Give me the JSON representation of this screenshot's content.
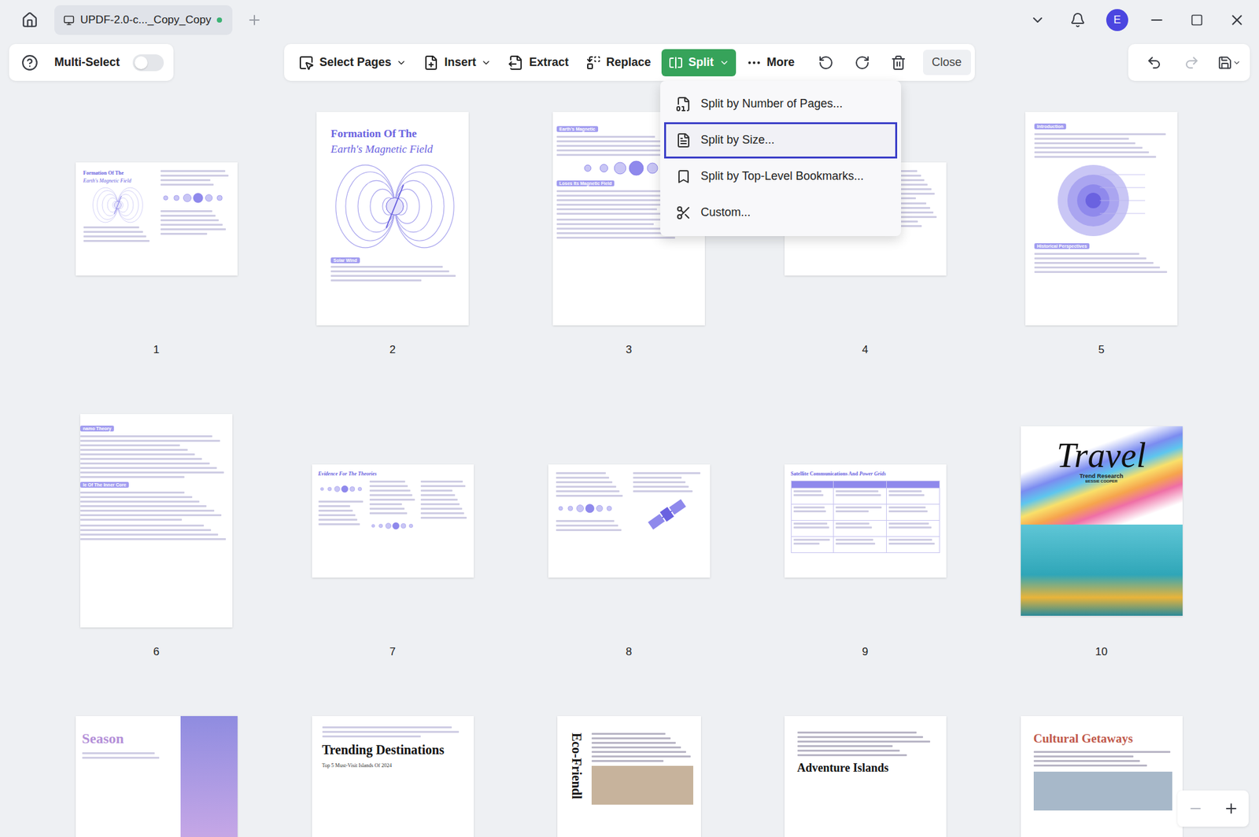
{
  "window": {
    "tabs": [
      {
        "label": "UPDF-2.0-c..._Copy_Copy",
        "selected": true,
        "unsaved": true
      }
    ],
    "account": {
      "initial": "E"
    }
  },
  "multi_select": {
    "label": "Multi-Select",
    "on": false
  },
  "toolbar": {
    "items": [
      {
        "label": "Select Pages",
        "kind": "menu",
        "selected": false
      },
      {
        "label": "Insert",
        "kind": "menu",
        "selected": false
      },
      {
        "label": "Extract",
        "kind": "button",
        "selected": false
      },
      {
        "label": "Replace",
        "kind": "button",
        "selected": false
      },
      {
        "label": "Split",
        "kind": "menu",
        "selected": true
      },
      {
        "label": "More",
        "kind": "button",
        "selected": false
      }
    ],
    "close": "Close"
  },
  "history": {
    "undo_disabled": false,
    "redo_disabled": true
  },
  "split_menu": {
    "open": true,
    "items": [
      {
        "label": "Split by Number of Pages...",
        "selected": false
      },
      {
        "label": "Split by Size...",
        "selected": true
      },
      {
        "label": "Split by Top-Level Bookmarks...",
        "selected": false
      },
      {
        "label": "Custom...",
        "selected": false
      }
    ]
  },
  "pages": [
    {
      "number": "1",
      "kind": "title-spread",
      "selected": false,
      "title": "Formation Of The",
      "subtitle": "Earth's Magnetic Field",
      "tags": []
    },
    {
      "number": "2",
      "kind": "field-cover",
      "selected": false,
      "title": "Formation Of The",
      "subtitle": "Earth's Magnetic Field",
      "tags": [
        "Solar Wind"
      ]
    },
    {
      "number": "3",
      "kind": "planets-article",
      "selected": false,
      "tags": [
        "Earth's Magnetic",
        "Loses Its Magnetic Field"
      ]
    },
    {
      "number": "4",
      "kind": "text-spread",
      "selected": false,
      "tags": []
    },
    {
      "number": "5",
      "kind": "core-article",
      "selected": false,
      "tags": [
        "Introduction",
        "Historical Perspectives"
      ]
    },
    {
      "number": "6",
      "kind": "theory-article",
      "selected": false,
      "tags": [
        "namo Theory",
        "le Of The Inner Core"
      ]
    },
    {
      "number": "7",
      "kind": "evidence-spread",
      "selected": false,
      "title": "Evidence For The Theories",
      "tags": []
    },
    {
      "number": "8",
      "kind": "satellite-spread",
      "selected": false,
      "tags": []
    },
    {
      "number": "9",
      "kind": "table-spread",
      "selected": false,
      "title": "Satellite Communications And",
      "subtitle": "Power Grids",
      "tags": []
    },
    {
      "number": "10",
      "kind": "travel-poster",
      "selected": false,
      "title": "Travel",
      "subtitle": "Trend Research",
      "author": "BESSIE COOPER",
      "tags": []
    },
    {
      "number": "",
      "kind": "season-leaflet",
      "selected": false,
      "title": "Season",
      "tags": []
    },
    {
      "number": "",
      "kind": "destinations-leaflet",
      "selected": false,
      "title": "Trending Destinations",
      "subtitle": "Top 5 Must-Visit Islands Of 2024",
      "tags": []
    },
    {
      "number": "",
      "kind": "eco-leaflet",
      "selected": false,
      "title": "Eco-Friendl",
      "tags": []
    },
    {
      "number": "",
      "kind": "islands-leaflet",
      "selected": false,
      "title": "Adventure Islands",
      "tags": []
    },
    {
      "number": "",
      "kind": "getaways-leaflet",
      "selected": false,
      "title": "Cultural Getaways",
      "tags": []
    }
  ],
  "zoom": {
    "out_disabled": true
  }
}
